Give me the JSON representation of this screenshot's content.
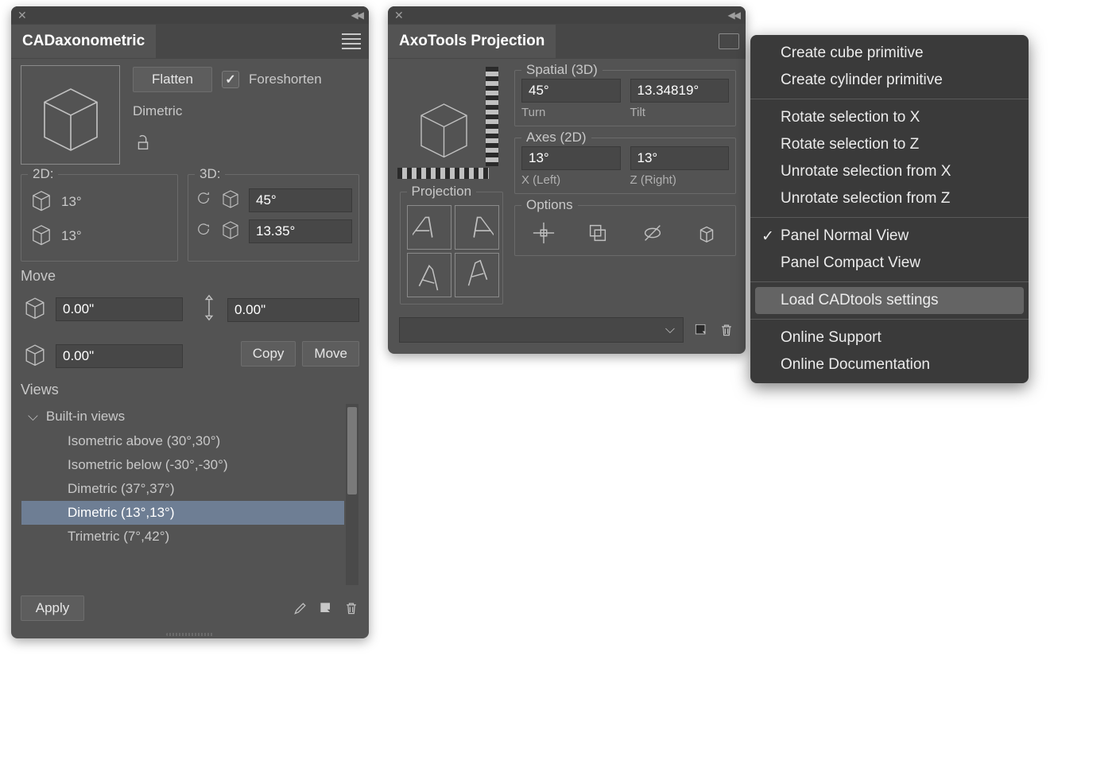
{
  "panel1": {
    "title": "CADaxonometric",
    "flatten_label": "Flatten",
    "foreshorten_label": "Foreshorten",
    "mode": "Dimetric",
    "group2d_title": "2D:",
    "group3d_title": "3D:",
    "angle2d_a": "13°",
    "angle2d_b": "13°",
    "angle3d_a": "45°",
    "angle3d_b": "13.35°",
    "move_title": "Move",
    "move_x": "0.00\"",
    "move_y": "0.00\"",
    "move_z": "0.00\"",
    "copy_label": "Copy",
    "movebtn_label": "Move",
    "views_title": "Views",
    "builtin_header": "Built-in views",
    "views": [
      "Isometric above (30°,30°)",
      "Isometric below (-30°,-30°)",
      "Dimetric (37°,37°)",
      "Dimetric (13°,13°)",
      "Trimetric (7°,42°)"
    ],
    "selected_view_index": 3,
    "apply_label": "Apply"
  },
  "panel2": {
    "title": "AxoTools Projection",
    "projection_group": "Projection",
    "spatial_group": "Spatial (3D)",
    "axes_group": "Axes (2D)",
    "options_group": "Options",
    "turn_val": "45°",
    "turn_label": "Turn",
    "tilt_val": "13.34819°",
    "tilt_label": "Tilt",
    "xleft_val": "13°",
    "xleft_label": "X (Left)",
    "zright_val": "13°",
    "zright_label": "Z (Right)"
  },
  "menu": {
    "items": [
      "Create cube primitive",
      "Create cylinder primitive",
      "Rotate selection to X",
      "Rotate selection to Z",
      "Unrotate selection from X",
      "Unrotate selection from Z",
      "Panel Normal View",
      "Panel Compact View",
      "Load CADtools settings",
      "Online Support",
      "Online Documentation"
    ]
  }
}
